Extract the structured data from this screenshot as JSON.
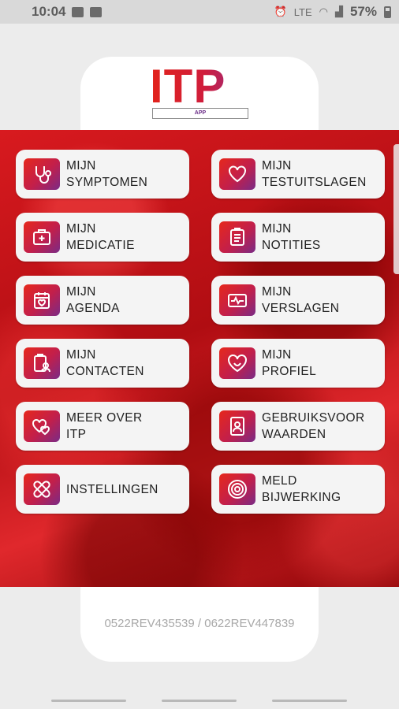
{
  "status_bar": {
    "time": "10:04",
    "network": "LTE",
    "battery": "57%"
  },
  "logo": {
    "word": "ITP",
    "sub": "APP"
  },
  "menu": [
    {
      "label": "MIJN\nSYMPTOMEN",
      "icon": "stethoscope-icon"
    },
    {
      "label": "MIJN\nTESTUITSLAGEN",
      "icon": "heart-icon"
    },
    {
      "label": "MIJN\nMEDICATIE",
      "icon": "medical-kit-icon"
    },
    {
      "label": "MIJN\nNOTITIES",
      "icon": "clipboard-icon"
    },
    {
      "label": "MIJN\nAGENDA",
      "icon": "calendar-heart-icon"
    },
    {
      "label": "MIJN\nVERSLAGEN",
      "icon": "report-folder-icon"
    },
    {
      "label": "MIJN\nCONTACTEN",
      "icon": "contact-clipboard-icon"
    },
    {
      "label": "MIJN\nPROFIEL",
      "icon": "heart-face-icon"
    },
    {
      "label": "MEER OVER\nITP",
      "icon": "hearts-icon"
    },
    {
      "label": "GEBRUIKSVOOR\nWAARDEN",
      "icon": "id-badge-icon"
    },
    {
      "label": "INSTELLINGEN",
      "icon": "bandage-icon"
    },
    {
      "label": "MELD\nBIJWERKING",
      "icon": "target-icon"
    }
  ],
  "footer": {
    "version": "0522REV435539 / 0622REV447839"
  },
  "colors": {
    "accent_red": "#e2231a",
    "accent_purple": "#7a2b86",
    "tile_bg": "#f4f4f4"
  }
}
